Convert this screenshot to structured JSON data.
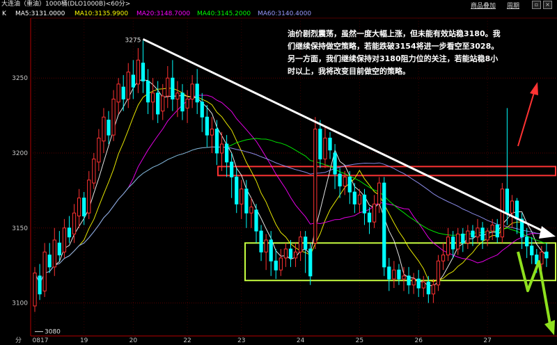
{
  "header": {
    "title": "大连油（重油）1000桶(DLO1000B)<60分>",
    "btn_add": "商品叠加",
    "btn_period": "周期"
  },
  "ma_labels": [
    {
      "key": "k",
      "text": "K",
      "color": "#ffffff"
    },
    {
      "key": "ma5",
      "text": "MA5:3131.0000",
      "color": "#ffffff"
    },
    {
      "key": "ma10",
      "text": "MA10:3135.9900",
      "color": "#ffff00"
    },
    {
      "key": "ma20",
      "text": "MA20:3148.7000",
      "color": "#ff00ff"
    },
    {
      "key": "ma40",
      "text": "MA40:3145.2000",
      "color": "#00ff00"
    },
    {
      "key": "ma60",
      "text": "MA60:3140.4000",
      "color": "#9999ff"
    }
  ],
  "annotation": "油价剧烈震荡，虽然一度大幅上涨，但未能有效站稳3180。我们继续保持做空策略，若能跌破3154将进一步看空至3028。另一方面，我们继续保持对3180阻力位的关注，若能站稳8小时以上，我将改变目前做空的策略。",
  "chart_data": {
    "type": "candlestick",
    "title": "大连油（重油）1000桶(DLO1000B)<60分>",
    "ylim": [
      3078,
      3290
    ],
    "y_ticks": [
      3100,
      3150,
      3200,
      3250
    ],
    "x_label": "分",
    "x_ticks": [
      "0817",
      "19",
      "20",
      "22",
      "23",
      "24",
      "25",
      "26",
      "27"
    ],
    "high_marker": {
      "label": "3275",
      "value": 3275
    },
    "low_marker": {
      "label": "3080",
      "value": 3080
    },
    "resistance_zone": [
      3185,
      3191
    ],
    "support_zone": [
      3115,
      3140
    ],
    "candles": [
      [
        3098,
        3120,
        3094,
        3124
      ],
      [
        3118,
        3106,
        3102,
        3126
      ],
      [
        3108,
        3134,
        3104,
        3140
      ],
      [
        3132,
        3124,
        3120,
        3140
      ],
      [
        3124,
        3142,
        3118,
        3150
      ],
      [
        3140,
        3132,
        3128,
        3148
      ],
      [
        3134,
        3150,
        3130,
        3156
      ],
      [
        3150,
        3144,
        3140,
        3158
      ],
      [
        3146,
        3160,
        3140,
        3166
      ],
      [
        3158,
        3170,
        3150,
        3176
      ],
      [
        3170,
        3158,
        3152,
        3174
      ],
      [
        3160,
        3182,
        3156,
        3188
      ],
      [
        3180,
        3196,
        3176,
        3200
      ],
      [
        3194,
        3210,
        3188,
        3216
      ],
      [
        3208,
        3224,
        3200,
        3230
      ],
      [
        3222,
        3212,
        3206,
        3228
      ],
      [
        3212,
        3236,
        3208,
        3242
      ],
      [
        3234,
        3246,
        3226,
        3250
      ],
      [
        3244,
        3236,
        3228,
        3252
      ],
      [
        3236,
        3254,
        3230,
        3260
      ],
      [
        3252,
        3244,
        3236,
        3262
      ],
      [
        3246,
        3262,
        3240,
        3270
      ],
      [
        3260,
        3248,
        3240,
        3275
      ],
      [
        3248,
        3234,
        3226,
        3256
      ],
      [
        3234,
        3240,
        3222,
        3250
      ],
      [
        3240,
        3226,
        3220,
        3248
      ],
      [
        3228,
        3238,
        3222,
        3246
      ],
      [
        3238,
        3250,
        3230,
        3258
      ],
      [
        3250,
        3236,
        3228,
        3262
      ],
      [
        3236,
        3240,
        3224,
        3248
      ],
      [
        3240,
        3228,
        3222,
        3246
      ],
      [
        3230,
        3236,
        3220,
        3242
      ],
      [
        3236,
        3246,
        3230,
        3252
      ],
      [
        3246,
        3234,
        3226,
        3256
      ],
      [
        3234,
        3224,
        3214,
        3240
      ],
      [
        3224,
        3212,
        3204,
        3232
      ],
      [
        3212,
        3216,
        3200,
        3224
      ],
      [
        3216,
        3200,
        3192,
        3222
      ],
      [
        3200,
        3206,
        3188,
        3214
      ],
      [
        3206,
        3194,
        3184,
        3212
      ],
      [
        3194,
        3184,
        3170,
        3200
      ],
      [
        3184,
        3166,
        3160,
        3190
      ],
      [
        3166,
        3176,
        3156,
        3182
      ],
      [
        3176,
        3160,
        3150,
        3182
      ],
      [
        3160,
        3164,
        3150,
        3170
      ],
      [
        3162,
        3148,
        3140,
        3166
      ],
      [
        3148,
        3134,
        3128,
        3152
      ],
      [
        3134,
        3142,
        3122,
        3146
      ],
      [
        3142,
        3128,
        3118,
        3148
      ],
      [
        3128,
        3122,
        3116,
        3136
      ],
      [
        3122,
        3130,
        3118,
        3136
      ],
      [
        3130,
        3136,
        3124,
        3140
      ],
      [
        3136,
        3130,
        3124,
        3142
      ],
      [
        3130,
        3134,
        3124,
        3140
      ],
      [
        3134,
        3144,
        3128,
        3148
      ],
      [
        3144,
        3136,
        3120,
        3148
      ],
      [
        3136,
        3118,
        3112,
        3140
      ],
      [
        3140,
        3216,
        3136,
        3224
      ],
      [
        3216,
        3196,
        3190,
        3222
      ],
      [
        3196,
        3210,
        3190,
        3218
      ],
      [
        3210,
        3202,
        3196,
        3214
      ],
      [
        3200,
        3186,
        3176,
        3206
      ],
      [
        3186,
        3178,
        3170,
        3190
      ],
      [
        3178,
        3184,
        3172,
        3188
      ],
      [
        3184,
        3174,
        3166,
        3188
      ],
      [
        3174,
        3166,
        3160,
        3180
      ],
      [
        3166,
        3172,
        3160,
        3176
      ],
      [
        3172,
        3160,
        3152,
        3176
      ],
      [
        3160,
        3154,
        3146,
        3164
      ],
      [
        3154,
        3166,
        3150,
        3172
      ],
      [
        3166,
        3180,
        3160,
        3184
      ],
      [
        3180,
        3124,
        3118,
        3184
      ],
      [
        3124,
        3116,
        3108,
        3130
      ],
      [
        3116,
        3122,
        3110,
        3128
      ],
      [
        3122,
        3116,
        3112,
        3126
      ],
      [
        3116,
        3118,
        3108,
        3124
      ],
      [
        3118,
        3112,
        3106,
        3124
      ],
      [
        3112,
        3116,
        3106,
        3120
      ],
      [
        3116,
        3110,
        3104,
        3122
      ],
      [
        3110,
        3114,
        3104,
        3118
      ],
      [
        3114,
        3106,
        3100,
        3118
      ],
      [
        3106,
        3112,
        3100,
        3116
      ],
      [
        3112,
        3128,
        3108,
        3132
      ],
      [
        3128,
        3132,
        3122,
        3140
      ],
      [
        3132,
        3144,
        3128,
        3150
      ],
      [
        3144,
        3136,
        3130,
        3148
      ],
      [
        3136,
        3146,
        3132,
        3150
      ],
      [
        3146,
        3140,
        3134,
        3150
      ],
      [
        3140,
        3148,
        3136,
        3152
      ],
      [
        3148,
        3144,
        3138,
        3152
      ],
      [
        3144,
        3150,
        3140,
        3156
      ],
      [
        3150,
        3142,
        3136,
        3154
      ],
      [
        3142,
        3148,
        3138,
        3150
      ],
      [
        3148,
        3152,
        3142,
        3156
      ],
      [
        3152,
        3144,
        3140,
        3156
      ],
      [
        3144,
        3176,
        3140,
        3180
      ],
      [
        3176,
        3160,
        3152,
        3230
      ],
      [
        3160,
        3168,
        3150,
        3172
      ],
      [
        3168,
        3156,
        3146,
        3170
      ],
      [
        3156,
        3144,
        3136,
        3160
      ],
      [
        3144,
        3138,
        3130,
        3150
      ],
      [
        3138,
        3132,
        3126,
        3144
      ],
      [
        3132,
        3126,
        3120,
        3136
      ],
      [
        3126,
        3134,
        3122,
        3138
      ],
      [
        3134,
        3130,
        3124,
        3140
      ]
    ]
  }
}
